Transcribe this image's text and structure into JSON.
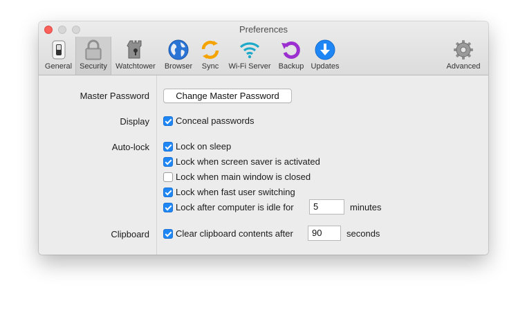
{
  "window": {
    "title": "Preferences"
  },
  "toolbar": {
    "items": [
      {
        "label": "General",
        "icon": "switch-icon"
      },
      {
        "label": "Security",
        "icon": "padlock-icon"
      },
      {
        "label": "Watchtower",
        "icon": "watchtower-icon"
      },
      {
        "label": "Browser",
        "icon": "globe-icon"
      },
      {
        "label": "Sync",
        "icon": "sync-icon"
      },
      {
        "label": "Wi-Fi Server",
        "icon": "wifi-icon"
      },
      {
        "label": "Backup",
        "icon": "backup-icon"
      },
      {
        "label": "Updates",
        "icon": "download-icon"
      },
      {
        "label": "Advanced",
        "icon": "gear-icon"
      }
    ],
    "selected": "Security"
  },
  "security": {
    "master_password": {
      "label": "Master Password",
      "button": "Change Master Password"
    },
    "display": {
      "label": "Display",
      "options": [
        {
          "label": "Conceal passwords",
          "checked": true
        }
      ]
    },
    "autolock": {
      "label": "Auto-lock",
      "options": [
        {
          "label": "Lock on sleep",
          "checked": true
        },
        {
          "label": "Lock when screen saver is activated",
          "checked": true
        },
        {
          "label": "Lock when main window is closed",
          "checked": false
        },
        {
          "label": "Lock when fast user switching",
          "checked": true
        },
        {
          "label": "Lock after computer is idle for",
          "checked": true
        }
      ],
      "idle_value": "5",
      "idle_unit": "minutes"
    },
    "clipboard": {
      "label": "Clipboard",
      "option": {
        "label": "Clear clipboard contents after",
        "checked": true
      },
      "value": "90",
      "unit": "seconds"
    }
  },
  "colors": {
    "accent": "#1f86f5",
    "close": "#fc605b",
    "backup": "#9b2fd0",
    "sync": "#f5a300"
  }
}
